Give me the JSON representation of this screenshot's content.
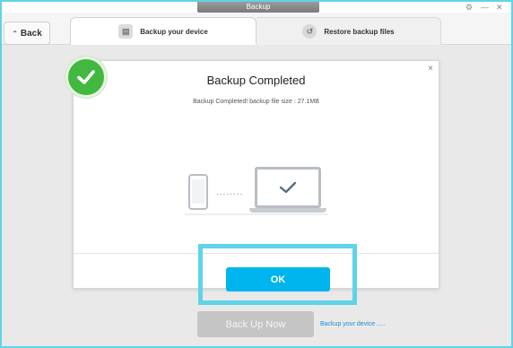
{
  "window": {
    "title": "Backup",
    "controls": [
      "⚙",
      "—",
      "✕"
    ]
  },
  "nav": {
    "back_label": "Back"
  },
  "tabs": [
    {
      "label": "Backup your device",
      "active": true
    },
    {
      "label": "Restore backup files",
      "active": false
    }
  ],
  "dialog": {
    "title": "Backup Completed",
    "message": "Backup Completed! backup file size : 27.1MB",
    "close_glyph": "×",
    "ok_label": "OK",
    "connector_dots": "........"
  },
  "footer": {
    "backup_now_label": "Back Up Now",
    "link_text": "Backup your device ....."
  },
  "colors": {
    "accent": "#00b5ee",
    "highlight": "#5fd3e8",
    "success": "#43b73f",
    "link": "#1a8fd6"
  }
}
